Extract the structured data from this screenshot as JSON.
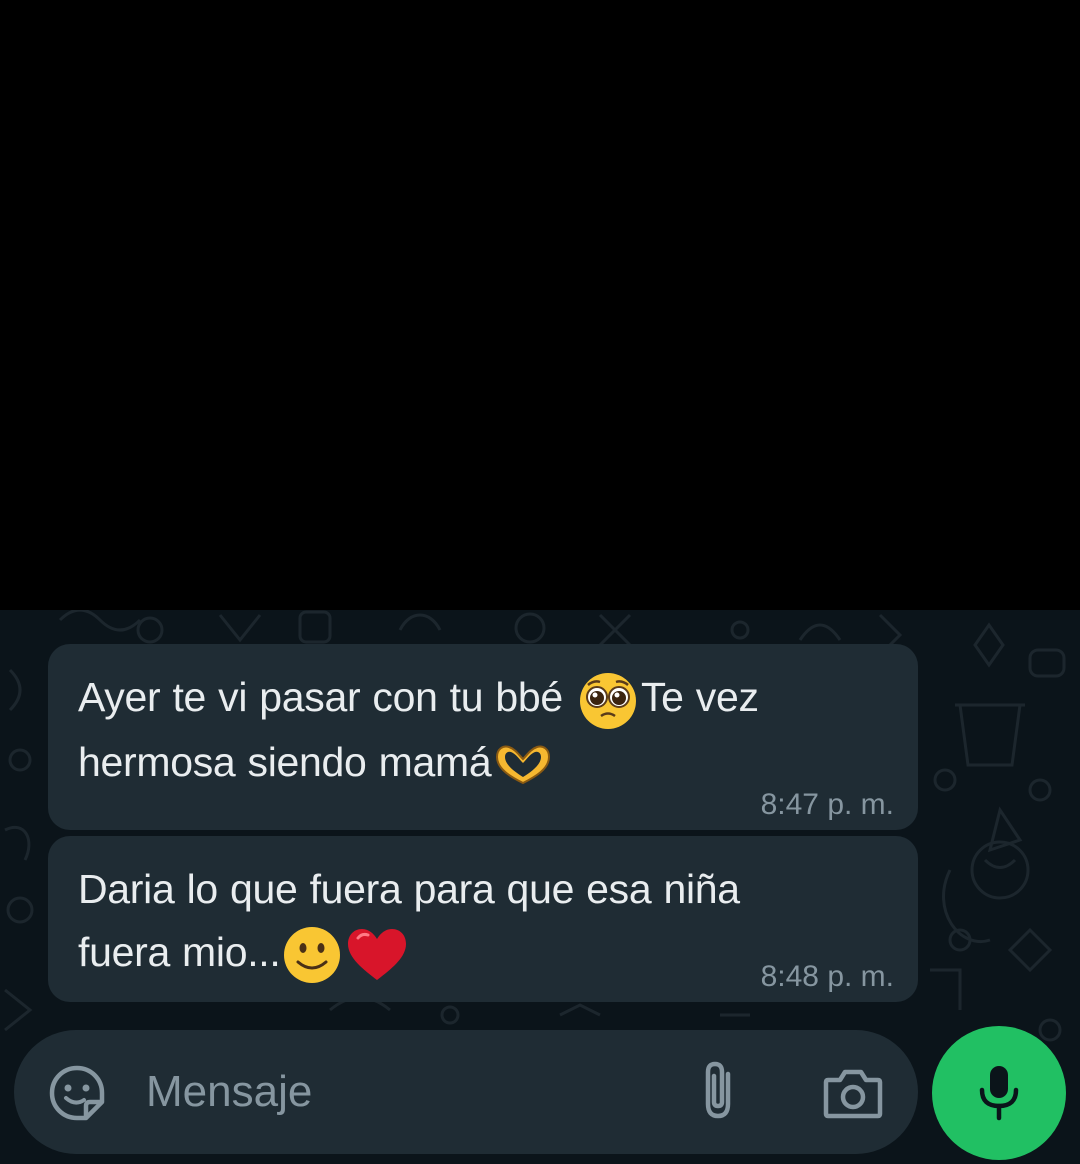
{
  "chat": {
    "messages": [
      {
        "line1_before": "Ayer te vi pasar con tu bbé ",
        "emoji1": "pleading-face",
        "line1_after": "Te vez",
        "line2": "hermosa siendo mamá",
        "emoji2": "heart-hands",
        "time": "8:47 p. m."
      },
      {
        "line1": "Daria lo que fuera para que esa niña",
        "line2": "fuera mio...",
        "emoji1": "slightly-smiling-face",
        "emoji2": "red-heart",
        "time": "8:48 p. m."
      }
    ]
  },
  "composer": {
    "placeholder": "Mensaje",
    "icons": [
      "emoji-sticker-icon",
      "paperclip-icon",
      "camera-icon"
    ]
  },
  "send_button": {
    "icon": "microphone-icon"
  },
  "colors": {
    "background": "#000000",
    "chat_background": "#0b141a",
    "bubble": "#1f2c34",
    "text": "#e9edef",
    "meta_text": "#8696a0",
    "accent": "#21c063"
  }
}
